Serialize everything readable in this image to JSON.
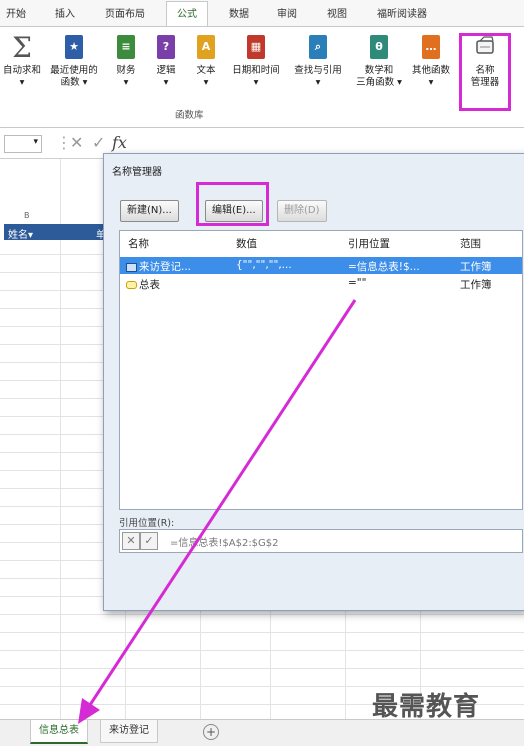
{
  "ribbon_tabs": [
    "开始",
    "插入",
    "页面布局",
    "公式",
    "数据",
    "审阅",
    "视图",
    "福昕阅读器"
  ],
  "ribbon_buttons": [
    {
      "label": "自动求和",
      "sub": "▾",
      "icon": "sigma-icon",
      "color": "#666666"
    },
    {
      "label": "最近使用的",
      "sub": "函数 ▾",
      "icon": "star-book-icon",
      "color": "#2f5ea8"
    },
    {
      "label": "财务",
      "sub": "▾",
      "icon": "finance-book-icon",
      "color": "#3d8b3d"
    },
    {
      "label": "逻辑",
      "sub": "▾",
      "icon": "logic-book-icon",
      "color": "#7a3fa8"
    },
    {
      "label": "文本",
      "sub": "▾",
      "icon": "text-book-icon",
      "color": "#e0a21f"
    },
    {
      "label": "日期和时间",
      "sub": "▾",
      "icon": "calendar-book-icon",
      "color": "#c0392b"
    },
    {
      "label": "查找与引用",
      "sub": "▾",
      "icon": "lookup-book-icon",
      "color": "#2a7fb8"
    },
    {
      "label": "数学和",
      "sub": "三角函数 ▾",
      "icon": "math-book-icon",
      "color": "#2e8b7a"
    },
    {
      "label": "其他函数",
      "sub": "▾",
      "icon": "more-book-icon",
      "color": "#e07020"
    },
    {
      "label": "名称",
      "sub": "管理器",
      "icon": "name-manager-icon",
      "color": "#555555"
    }
  ],
  "ribbon_group_label": "函数库",
  "formula_bar": {
    "cancel_glyph": "✕",
    "enter_glyph": "✓",
    "fx_glyph": "fx"
  },
  "sheet": {
    "column_letter": "B",
    "header_cell_1": "姓名▾",
    "header_cell_2": "单"
  },
  "dialog": {
    "title": "名称管理器",
    "buttons": {
      "new": "新建(N)...",
      "edit": "编辑(E)...",
      "delete": "删除(D)"
    },
    "columns": [
      "名称",
      "数值",
      "引用位置",
      "范围"
    ],
    "rows": [
      {
        "name": "来访登记...",
        "value": "{\"\",\"\",\"\",...",
        "ref": "=信息总表!$...",
        "scope": "工作簿",
        "selected": true,
        "icon": "table-icon"
      },
      {
        "name": "总表",
        "value": "",
        "ref": "=\"\"",
        "scope": "工作簿",
        "selected": false,
        "icon": "named-range-icon"
      }
    ],
    "refers_to_label": "引用位置(R):",
    "refers_to_value": "=信息总表!$A$2:$G$2"
  },
  "sheet_tabs": [
    "信息总表",
    "来访登记"
  ],
  "add_sheet_glyph": "+",
  "watermark": "最需教育",
  "accent": {
    "highlight": "#d52bd5",
    "selection": "#3d8ee8",
    "table_header": "#2d5a99"
  }
}
